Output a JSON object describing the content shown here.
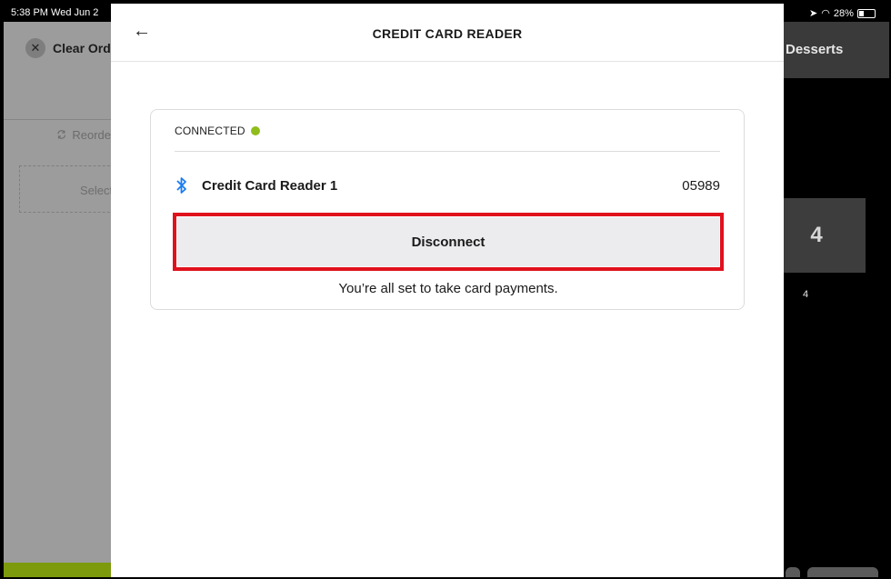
{
  "status_bar": {
    "time_date": "5:38 PM   Wed Jun 2",
    "battery": "28%"
  },
  "background_left": {
    "clear_order_label": "Clear Orde",
    "reorder_label": "Reorde",
    "select_label": "Select"
  },
  "background_right": {
    "category_label": "Desserts",
    "tile_value": "4",
    "tile_subvalue": "4"
  },
  "modal": {
    "back_icon": "←",
    "title": "CREDIT CARD READER",
    "connection_status": "CONNECTED",
    "status_color": "#8fbd1d",
    "reader_name": "Credit Card Reader 1",
    "reader_serial": "05989",
    "bluetooth_icon": "bluetooth-icon",
    "bluetooth_color": "#1a7cf2",
    "disconnect_label": "Disconnect",
    "highlight_color": "#e0111d",
    "status_message": "You’re all set to take card payments."
  }
}
